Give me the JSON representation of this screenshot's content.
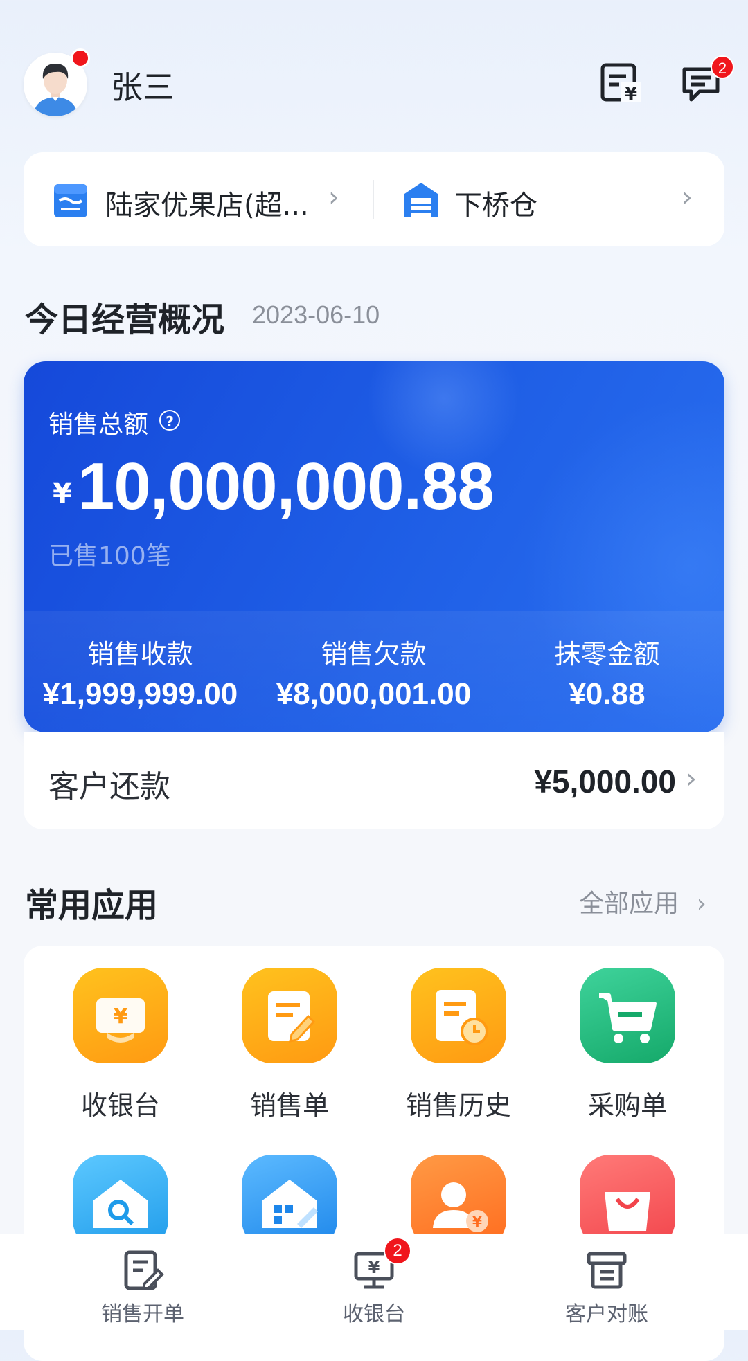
{
  "header": {
    "username": "张三",
    "messages_badge": "2"
  },
  "stores": {
    "store_name": "陆家优果店(超...",
    "warehouse_name": "下桥仓"
  },
  "overview": {
    "title": "今日经营概况",
    "date": "2023-06-10",
    "total_label": "销售总额",
    "help_glyph": "?",
    "currency": "¥",
    "total_amount": "10,000,000.88",
    "sold_count": "已售100笔",
    "stats": [
      {
        "label": "销售收款",
        "value": "¥1,999,999.00"
      },
      {
        "label": "销售欠款",
        "value": "¥8,000,001.00"
      },
      {
        "label": "抹零金额",
        "value": "¥0.88"
      }
    ],
    "repayment_label": "客户还款",
    "repayment_amount": "¥5,000.00"
  },
  "apps": {
    "title": "常用应用",
    "all_label": "全部应用",
    "items": [
      {
        "label": "收银台",
        "icon": "cashier-icon",
        "color": "#ffa21a"
      },
      {
        "label": "销售单",
        "icon": "sales-order-icon",
        "color": "#ffa21a"
      },
      {
        "label": "销售历史",
        "icon": "sales-history-icon",
        "color": "#ffa21a"
      },
      {
        "label": "采购单",
        "icon": "purchase-cart-icon",
        "color": "#1fb87a"
      },
      {
        "label": "",
        "icon": "store-search-icon",
        "color": "#2ba7f0"
      },
      {
        "label": "",
        "icon": "store-edit-icon",
        "color": "#2b94ef"
      },
      {
        "label": "",
        "icon": "customer-payment-icon",
        "color": "#ff7a2a"
      },
      {
        "label": "",
        "icon": "shopping-bag-icon",
        "color": "#ff5a5f"
      }
    ]
  },
  "tabbar": {
    "items": [
      {
        "label": "销售开单",
        "icon": "sales-form-icon"
      },
      {
        "label": "收银台",
        "icon": "cash-register-icon",
        "badge": "2"
      },
      {
        "label": "客户对账",
        "icon": "reconciliation-icon"
      }
    ]
  }
}
